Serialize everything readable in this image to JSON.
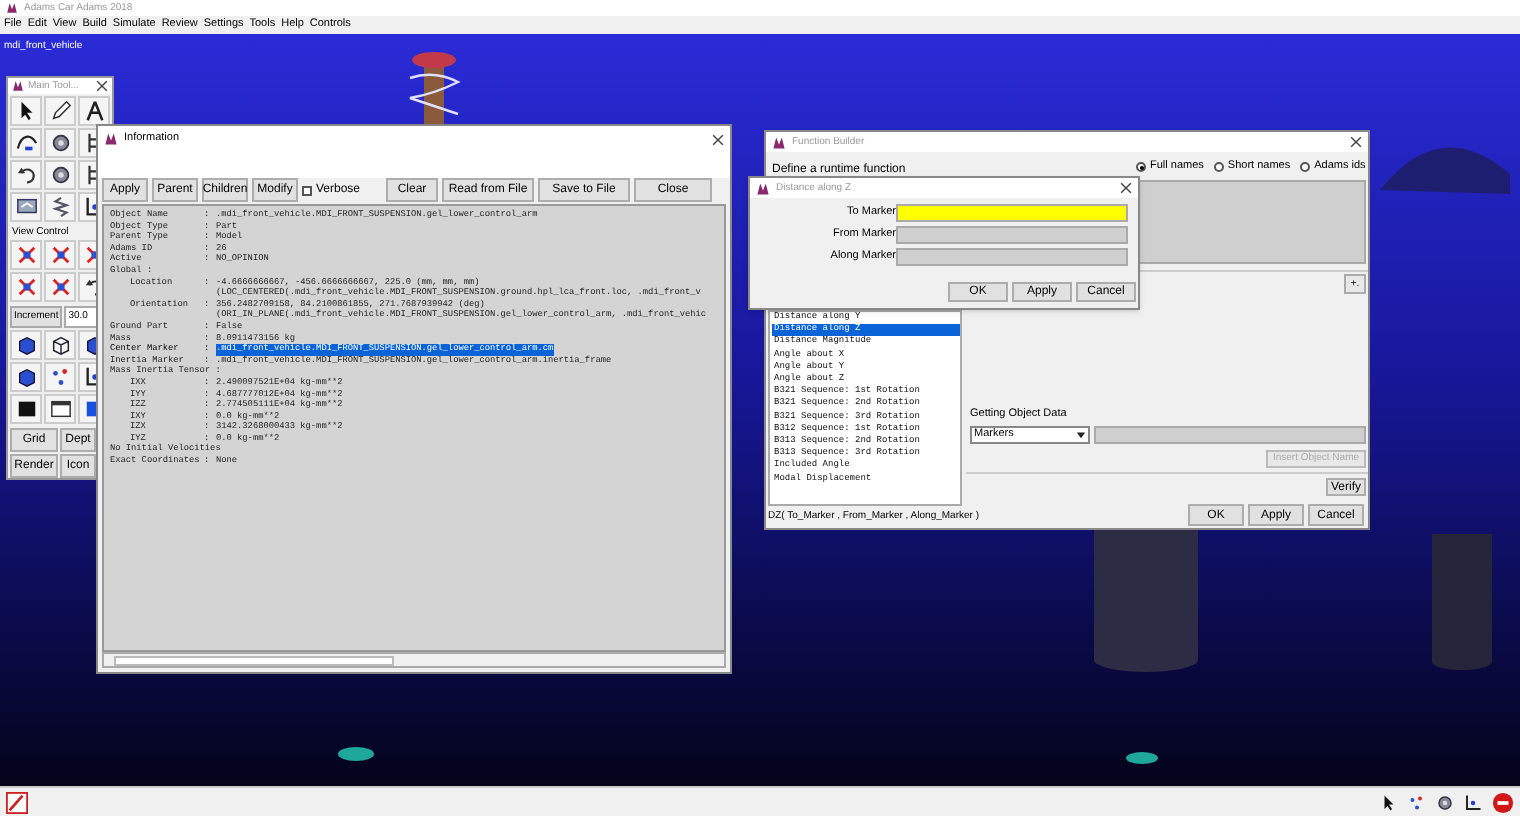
{
  "window": {
    "title": "Adams Car Adams 2018"
  },
  "menu": [
    "File",
    "Edit",
    "View",
    "Build",
    "Simulate",
    "Review",
    "Settings",
    "Tools",
    "Help",
    "Controls"
  ],
  "viewport": {
    "model_name": "mdi_front_vehicle"
  },
  "main_toolbox": {
    "title": "Main Tool...",
    "view_control_label": "View Control",
    "increment_label": "Increment",
    "increment_value": "30.0",
    "buttons": [
      "Grid",
      "Dept",
      "Render",
      "Icon"
    ]
  },
  "information": {
    "title": "Information",
    "controls": [
      {
        "kind": "button",
        "label": "Apply"
      },
      {
        "kind": "button",
        "label": "Parent"
      },
      {
        "kind": "button",
        "label": "Children"
      },
      {
        "kind": "button",
        "label": "Modify"
      },
      {
        "kind": "checkbox",
        "label": "Verbose",
        "checked": false
      },
      {
        "kind": "button",
        "label": "Clear"
      },
      {
        "kind": "button",
        "label": "Read from File"
      },
      {
        "kind": "button",
        "label": "Save to File"
      },
      {
        "kind": "button",
        "label": "Close"
      }
    ],
    "lines": [
      {
        "label": "Object Name",
        "sep": ":",
        "values": [
          ".mdi_front_vehicle.MDI_FRONT_SUSPENSION.gel_lower_control_arm"
        ],
        "selected": false
      },
      {
        "label": "Object Type",
        "sep": ":",
        "values": [
          "Part"
        ],
        "selected": false
      },
      {
        "label": "Parent Type",
        "sep": ":",
        "values": [
          "Model"
        ],
        "selected": false
      },
      {
        "label": "Adams ID",
        "sep": ":",
        "values": [
          "26"
        ],
        "selected": false
      },
      {
        "label": "Active",
        "sep": ":",
        "values": [
          "NO_OPINION"
        ],
        "selected": false
      },
      {
        "label": "Global :",
        "selected": false,
        "children": [
          {
            "label": "Location",
            "sep": ":",
            "values": [
              "-4.6666666667, -456.6666666667, 225.0 (mm, mm, mm)",
              "(LOC_CENTERED(.mdi_front_vehicle.MDI_FRONT_SUSPENSION.ground.hpl_lca_front.loc, .mdi_front_v"
            ],
            "selected": false
          },
          {
            "label": "Orientation",
            "sep": ":",
            "values": [
              "356.2482709158, 84.2100861855, 271.7687939942 (deg)",
              "(ORI_IN_PLANE(.mdi_front_vehicle.MDI_FRONT_SUSPENSION.gel_lower_control_arm, .mdi_front_vehic"
            ],
            "selected": false
          }
        ]
      },
      {
        "label": "Ground Part",
        "sep": ":",
        "values": [
          "False"
        ],
        "selected": false
      },
      {
        "label": "Mass",
        "sep": ":",
        "values": [
          "8.0911473156 kg"
        ],
        "selected": false
      },
      {
        "label": "Center Marker",
        "sep": ":",
        "values": [
          ".mdi_front_vehicle.MDI_FRONT_SUSPENSION.gel_lower_control_arm.cm"
        ],
        "selected": true
      },
      {
        "label": "Inertia Marker",
        "sep": ":",
        "values": [
          ".mdi_front_vehicle.MDI_FRONT_SUSPENSION.gel_lower_control_arm.inertia_frame"
        ],
        "selected": false
      },
      {
        "label": "Mass Inertia Tensor :",
        "selected": false,
        "children": [
          {
            "label": "IXX",
            "sep": ":",
            "values": [
              "2.490097521E+04 kg-mm**2"
            ],
            "selected": false
          },
          {
            "label": "IYY",
            "sep": ":",
            "values": [
              "4.687777012E+04 kg-mm**2"
            ],
            "selected": false
          },
          {
            "label": "IZZ",
            "sep": ":",
            "values": [
              "2.774505111E+04 kg-mm**2"
            ],
            "selected": false
          },
          {
            "label": "IXY",
            "sep": ":",
            "values": [
              "0.0 kg-mm**2"
            ],
            "selected": false
          },
          {
            "label": "IZX",
            "sep": ":",
            "values": [
              "3142.3268000433 kg-mm**2"
            ],
            "selected": false
          },
          {
            "label": "IYZ",
            "sep": ":",
            "values": [
              "0.0 kg-mm**2"
            ],
            "selected": false
          }
        ]
      },
      {
        "label": "No Initial Velocities",
        "selected": false
      },
      {
        "label": "Exact Coordinates",
        "sep": ":",
        "values": [
          "None"
        ],
        "selected": false
      }
    ]
  },
  "function_builder": {
    "title": "Function Builder",
    "prompt": "Define a runtime function",
    "name_modes": [
      {
        "label": "Full names",
        "selected": true
      },
      {
        "label": "Short names",
        "selected": false
      },
      {
        "label": "Adams ids",
        "selected": false
      }
    ],
    "expand_button": "+.",
    "functions": [
      {
        "label": "Distance along Y",
        "selected": false
      },
      {
        "label": "Distance along Z",
        "selected": true
      },
      {
        "label": "Distance Magnitude",
        "selected": false
      },
      {
        "label": "Angle about X",
        "selected": false
      },
      {
        "label": "Angle about Y",
        "selected": false
      },
      {
        "label": "Angle about Z",
        "selected": false
      },
      {
        "label": "B321 Sequence: 1st Rotation",
        "selected": false
      },
      {
        "label": "B321 Sequence: 2nd Rotation",
        "selected": false
      },
      {
        "label": "B321 Sequence: 3rd Rotation",
        "selected": false
      },
      {
        "label": "B312 Sequence: 1st Rotation",
        "selected": false
      },
      {
        "label": "B313 Sequence: 2nd Rotation",
        "selected": false
      },
      {
        "label": "B313 Sequence: 3rd Rotation",
        "selected": false
      },
      {
        "label": "Included Angle",
        "selected": false
      },
      {
        "label": "Modal Displacement",
        "selected": false
      }
    ],
    "object_data_label": "Getting Object Data",
    "object_type": "Markers",
    "insert_button": {
      "label": "Insert Object Name",
      "disabled": true
    },
    "verify_button": "Verify",
    "signature": "DZ( To_Marker , From_Marker , Along_Marker )",
    "buttons": [
      "OK",
      "Apply",
      "Cancel"
    ]
  },
  "distance_dialog": {
    "title": "Distance along Z",
    "fields": [
      {
        "label": "To Marker",
        "focused": true
      },
      {
        "label": "From Marker",
        "focused": false
      },
      {
        "label": "Along Marker",
        "focused": false
      }
    ],
    "buttons": [
      "OK",
      "Apply",
      "Cancel"
    ]
  }
}
